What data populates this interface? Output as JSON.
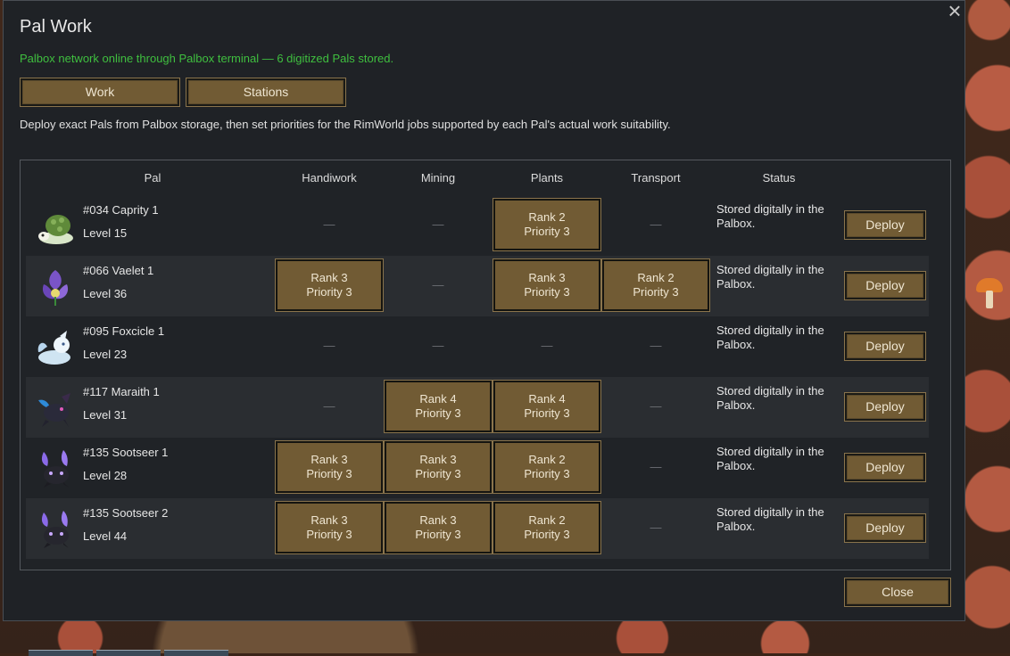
{
  "window": {
    "title": "Pal Work",
    "status": "Palbox network online through Palbox terminal — 6 digitized Pals stored.",
    "description": "Deploy exact Pals from Palbox storage, then set priorities for the RimWorld jobs supported by each Pal's actual work suitability.",
    "close_label": "Close",
    "close_icon": "×"
  },
  "tabs": [
    {
      "label": "Work"
    },
    {
      "label": "Stations"
    }
  ],
  "columns": {
    "pal": "Pal",
    "handiwork": "Handiwork",
    "mining": "Mining",
    "plants": "Plants",
    "transport": "Transport",
    "status": "Status"
  },
  "dash": "—",
  "rows": [
    {
      "name": "#034 Caprity 1",
      "level": "Level 15",
      "handiwork": "",
      "mining": "",
      "plants": {
        "rank": "Rank 2",
        "priority": "Priority 3"
      },
      "transport": "",
      "status": "Stored digitally in the Palbox.",
      "action": "Deploy"
    },
    {
      "name": "#066 Vaelet 1",
      "level": "Level 36",
      "handiwork": {
        "rank": "Rank 3",
        "priority": "Priority 3"
      },
      "mining": "",
      "plants": {
        "rank": "Rank 3",
        "priority": "Priority 3"
      },
      "transport": {
        "rank": "Rank 2",
        "priority": "Priority 3"
      },
      "status": "Stored digitally in the Palbox.",
      "action": "Deploy"
    },
    {
      "name": "#095 Foxcicle 1",
      "level": "Level 23",
      "handiwork": "",
      "mining": "",
      "plants": "",
      "transport": "",
      "status": "Stored digitally in the Palbox.",
      "action": "Deploy"
    },
    {
      "name": "#117 Maraith 1",
      "level": "Level 31",
      "handiwork": "",
      "mining": {
        "rank": "Rank 4",
        "priority": "Priority 3"
      },
      "plants": {
        "rank": "Rank 4",
        "priority": "Priority 3"
      },
      "transport": "",
      "status": "Stored digitally in the Palbox.",
      "action": "Deploy"
    },
    {
      "name": "#135 Sootseer 1",
      "level": "Level 28",
      "handiwork": {
        "rank": "Rank 3",
        "priority": "Priority 3"
      },
      "mining": {
        "rank": "Rank 3",
        "priority": "Priority 3"
      },
      "plants": {
        "rank": "Rank 2",
        "priority": "Priority 3"
      },
      "transport": "",
      "status": "Stored digitally in the Palbox.",
      "action": "Deploy"
    },
    {
      "name": "#135 Sootseer 2",
      "level": "Level 44",
      "handiwork": {
        "rank": "Rank 3",
        "priority": "Priority 3"
      },
      "mining": {
        "rank": "Rank 3",
        "priority": "Priority 3"
      },
      "plants": {
        "rank": "Rank 2",
        "priority": "Priority 3"
      },
      "transport": "",
      "status": "Stored digitally in the Palbox.",
      "action": "Deploy"
    }
  ],
  "icons": [
    "caprity-icon",
    "vaelet-icon",
    "foxcicle-icon",
    "maraith-icon",
    "sootseer-icon",
    "sootseer-icon"
  ]
}
